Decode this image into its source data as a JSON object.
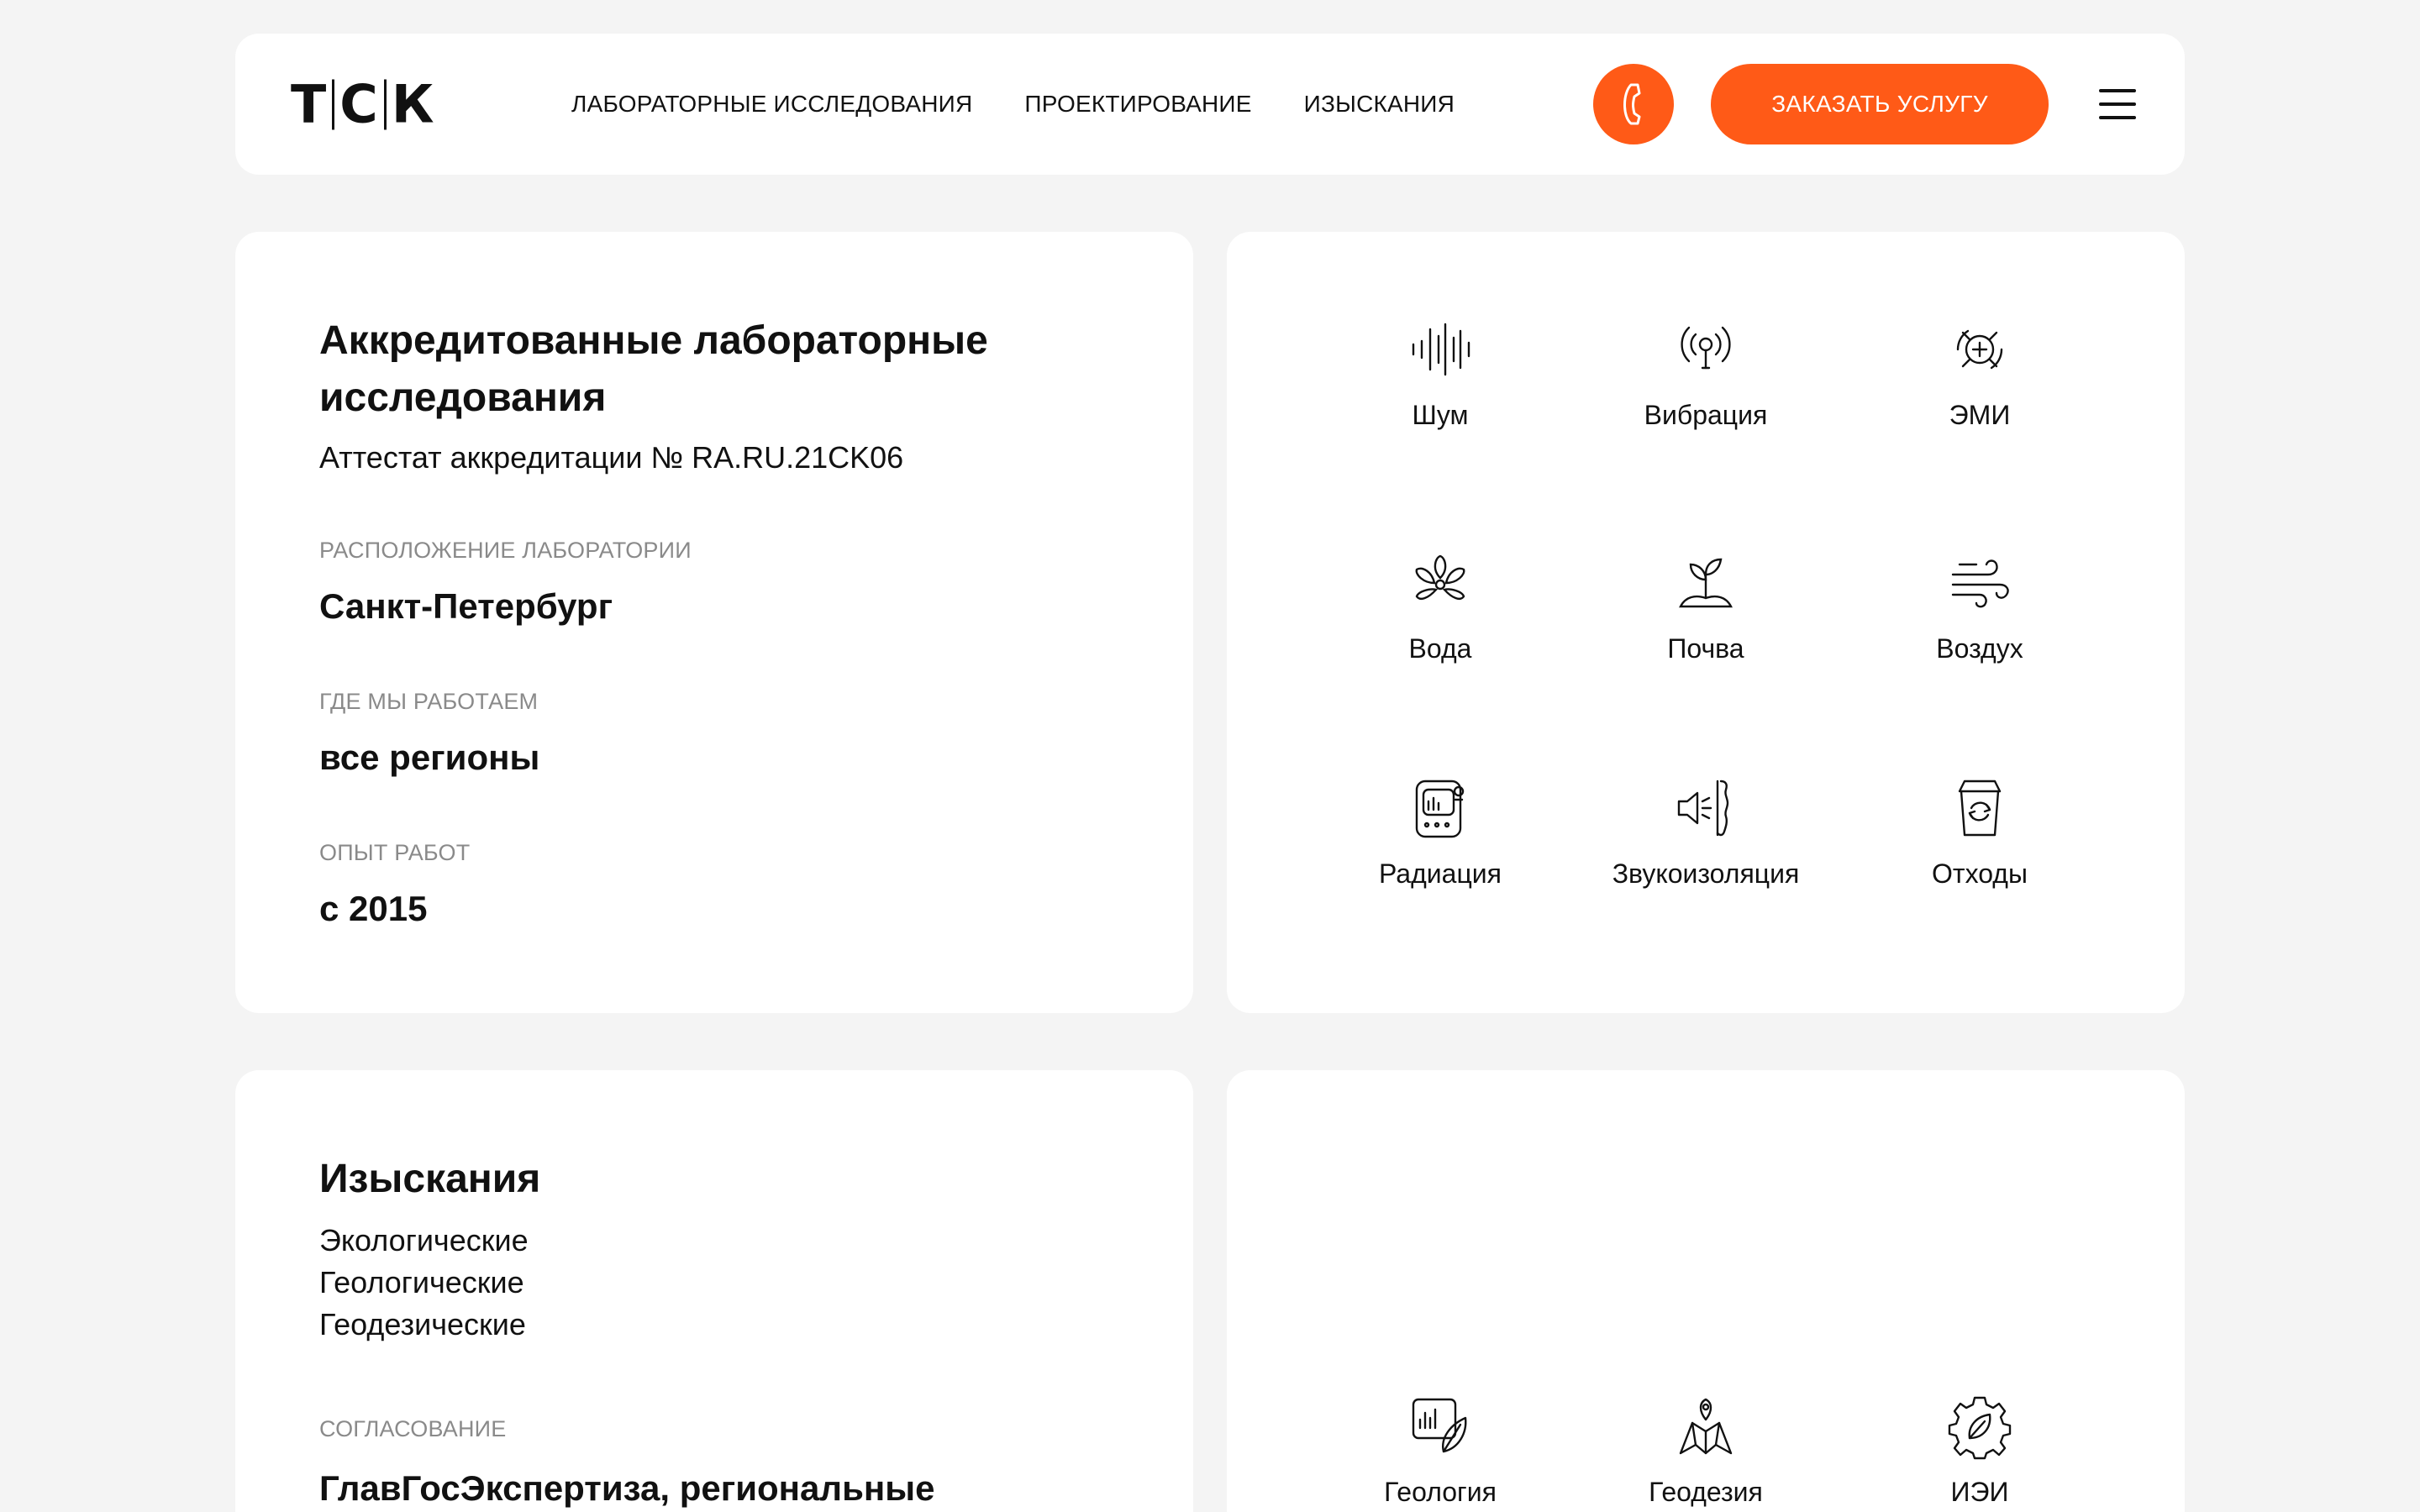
{
  "header": {
    "logo_left": "Т",
    "logo_mid": "С",
    "logo_right": "К",
    "nav": [
      "ЛАБОРАТОРНЫЕ ИССЛЕДОВАНИЯ",
      "ПРОЕКТИРОВАНИЕ",
      "ИЗЫСКАНИЯ"
    ],
    "order_button": "ЗАКАЗАТЬ УСЛУГУ",
    "accent_color": "#ff5a17"
  },
  "lab_card": {
    "title_line1": "Аккредитованные лабораторные",
    "title_line2": "исследования",
    "subtitle": "Аттестат аккредитации № RA.RU.21CK06",
    "location_label": "РАСПОЛОЖЕНИЕ ЛАБОРАТОРИИ",
    "location_value": "Санкт-Петербург",
    "regions_label": "ГДЕ МЫ РАБОТАЕМ",
    "regions_value": "все регионы",
    "experience_label": "ОПЫТ РАБОТ",
    "experience_value": "с 2015"
  },
  "lab_services": [
    {
      "label": "Шум",
      "icon": "sound-wave-icon"
    },
    {
      "label": "Вибрация",
      "icon": "vibration-icon"
    },
    {
      "label": "ЭМИ",
      "icon": "emi-icon"
    },
    {
      "label": "Вода",
      "icon": "water-icon"
    },
    {
      "label": "Почва",
      "icon": "soil-icon"
    },
    {
      "label": "Воздух",
      "icon": "air-icon"
    },
    {
      "label": "Радиация",
      "icon": "radiation-icon"
    },
    {
      "label": "Звукоизоляция",
      "icon": "soundproofing-icon"
    },
    {
      "label": "Отходы",
      "icon": "waste-icon"
    }
  ],
  "survey_card": {
    "title": "Изыскания",
    "items": [
      "Экологические",
      "Геологические",
      "Геодезические"
    ],
    "approval_label": "СОГЛАСОВАНИЕ",
    "approval_value": "ГлавГосЭкспертиза, региональные"
  },
  "survey_services": [
    {
      "label": "Геология",
      "icon": "geology-icon"
    },
    {
      "label": "Геодезия",
      "icon": "geodesy-icon"
    },
    {
      "label": "ИЭИ",
      "icon": "eco-survey-icon"
    }
  ]
}
